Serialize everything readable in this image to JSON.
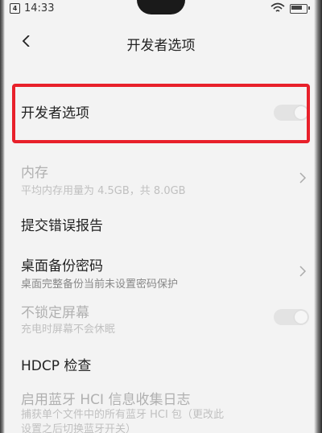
{
  "status_bar": {
    "sim_label": "4",
    "time": "14:33"
  },
  "header": {
    "title": "开发者选项"
  },
  "rows": [
    {
      "title": "开发者选项"
    },
    {
      "title": "内存",
      "sub": "平均内存用量为 4.5GB，共 8.0GB"
    },
    {
      "title": "提交错误报告"
    },
    {
      "title": "桌面备份密码",
      "sub": "桌面完整备份当前未设置密码保护"
    },
    {
      "title": "不锁定屏幕",
      "sub": "充电时屏幕不会休眠"
    },
    {
      "title": "HDCP 检查"
    },
    {
      "title": "启用蓝牙 HCI 信息收集日志",
      "sub": "捕获单个文件中的所有蓝牙 HCI 包（更改此",
      "sub2": "设置之后切换蓝牙开关）"
    }
  ],
  "colors": {
    "highlight": "#e8202a",
    "background": "#f3f3f3"
  }
}
